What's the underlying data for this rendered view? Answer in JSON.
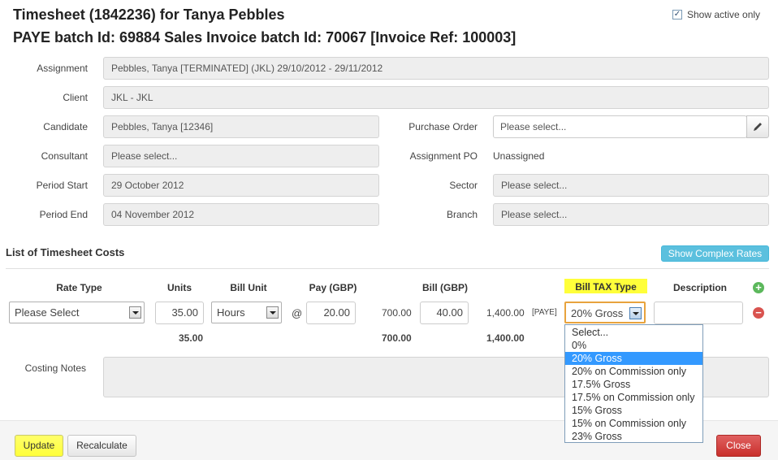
{
  "header": {
    "title": "Timesheet (1842236) for Tanya Pebbles",
    "subtitle": "PAYE batch Id: 69884 Sales Invoice batch Id: 70067 [Invoice Ref: 100003]",
    "show_active_label": "Show active only",
    "show_active_checked": true
  },
  "form": {
    "assignment": {
      "label": "Assignment",
      "value": "Pebbles, Tanya [TERMINATED] (JKL) 29/10/2012 - 29/11/2012"
    },
    "client": {
      "label": "Client",
      "value": "JKL - JKL"
    },
    "candidate": {
      "label": "Candidate",
      "value": "Pebbles, Tanya [12346]"
    },
    "consultant": {
      "label": "Consultant",
      "value": "Please select..."
    },
    "period_start": {
      "label": "Period Start",
      "value": "29 October 2012"
    },
    "period_end": {
      "label": "Period End",
      "value": "04 November 2012"
    },
    "purchase_order": {
      "label": "Purchase Order",
      "value": "Please select..."
    },
    "assignment_po": {
      "label": "Assignment PO",
      "value": "Unassigned"
    },
    "sector": {
      "label": "Sector",
      "value": "Please select..."
    },
    "branch": {
      "label": "Branch",
      "value": "Please select..."
    }
  },
  "costs": {
    "heading": "List of Timesheet Costs",
    "show_complex_rates": "Show Complex Rates",
    "columns": {
      "rate_type": "Rate Type",
      "units": "Units",
      "bill_unit": "Bill Unit",
      "pay": "Pay (GBP)",
      "bill": "Bill (GBP)",
      "bill_tax_type": "Bill TAX Type",
      "description": "Description"
    },
    "row": {
      "rate_type": "Please Select",
      "units": "35.00",
      "bill_unit": "Hours",
      "at": "@",
      "pay": "20.00",
      "pay_total": "700.00",
      "bill": "40.00",
      "bill_total": "1,400.00",
      "paye_tag": "[PAYE]",
      "bill_tax_type": "20% Gross",
      "description": ""
    },
    "totals": {
      "units": "35.00",
      "pay": "700.00",
      "bill": "1,400.00"
    },
    "tax_options": [
      "Select...",
      "0%",
      "20% Gross",
      "20% on Commission only",
      "17.5% Gross",
      "17.5% on Commission only",
      "15% Gross",
      "15% on Commission only",
      "23% Gross"
    ],
    "tax_selected_index": 2
  },
  "costing_notes": {
    "label": "Costing Notes",
    "value": ""
  },
  "footer": {
    "update": "Update",
    "recalculate": "Recalculate",
    "close": "Close"
  },
  "colors": {
    "accent_blue": "#5bc0de",
    "close_red": "#d9534f",
    "highlight": "#ffff3a",
    "selected_option": "#3399ff"
  },
  "icons": {
    "add": "plus-circle-icon",
    "remove": "minus-circle-icon",
    "edit": "pencil-icon",
    "dropdown": "chevron-down-icon"
  }
}
